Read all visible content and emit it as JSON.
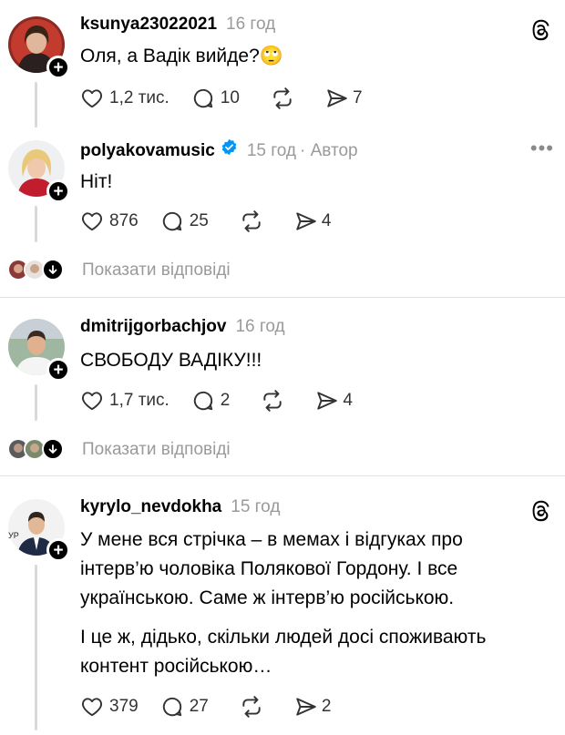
{
  "posts": [
    {
      "username": "ksunya23022021",
      "time": "16 год",
      "text_lines": [
        "Оля, а Вадік вийде?🙄"
      ],
      "likes": "1,2 тис.",
      "comments": "10",
      "shares": "7",
      "top_right_icon": "threads-logo-icon"
    },
    {
      "username": "polyakovamusic",
      "verified": true,
      "time": "15 год",
      "author_badge": "· Автор",
      "text_lines": [
        "Ніт!"
      ],
      "likes": "876",
      "comments": "25",
      "shares": "4",
      "top_right_icon": "more-icon",
      "more_glyph": "•••",
      "show_replies": "Показати відповіді"
    },
    {
      "username": "dmitrijgorbachjov",
      "time": "16 год",
      "text_lines": [
        "СВОБОДУ ВАДІКУ!!!"
      ],
      "likes": "1,7 тис.",
      "comments": "2",
      "shares": "4",
      "show_replies": "Показати відповіді"
    },
    {
      "username": "kyrylo_nevdokha",
      "time": "15 год",
      "text_lines": [
        "У мене вся стрічка – в мемах і відгуках про",
        "інтерв’ю чоловіка Полякової Гордону. І все",
        "українською. Саме ж інтерв’ю російською."
      ],
      "text_lines_2": [
        "І це ж, дідько, скільки людей досі споживають",
        "контент російською…"
      ],
      "avatar_text": "УР",
      "likes": "379",
      "comments": "27",
      "shares": "2",
      "top_right_icon": "threads-logo-icon"
    }
  ],
  "colors": {
    "text": "#000000",
    "muted": "#9a9a9a",
    "verified": "#0095f6",
    "divider": "#e3e3e3"
  }
}
